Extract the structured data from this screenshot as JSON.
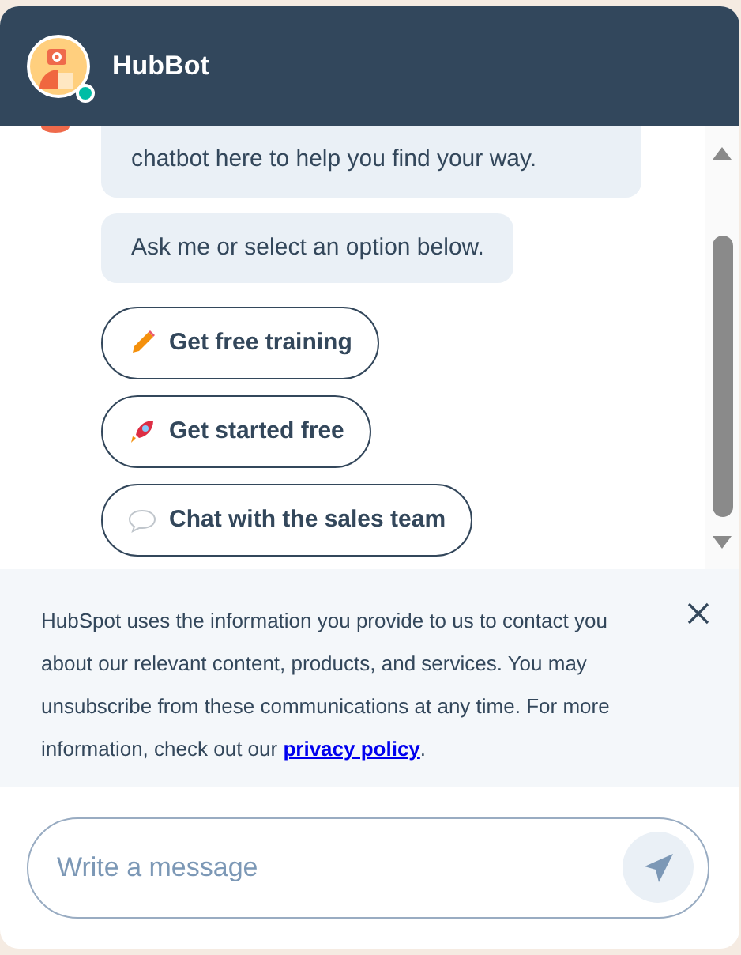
{
  "header": {
    "title": "HubBot",
    "online": true
  },
  "messages": [
    "chatbot here to help you find your way.",
    "Ask me or select an option below."
  ],
  "options": [
    {
      "label": "Get free training",
      "kind": "pencil"
    },
    {
      "label": "Get started free",
      "kind": "rocket"
    },
    {
      "label": "Chat with the sales team",
      "kind": "speech"
    }
  ],
  "notice": {
    "text": "HubSpot uses the information you provide to us to contact you about our relevant content, products, and services. You may unsubscribe from these communications at any time. For more information, check out our",
    "link": "privacy policy",
    "end": "."
  },
  "composer": {
    "placeholder": "Write a message"
  }
}
